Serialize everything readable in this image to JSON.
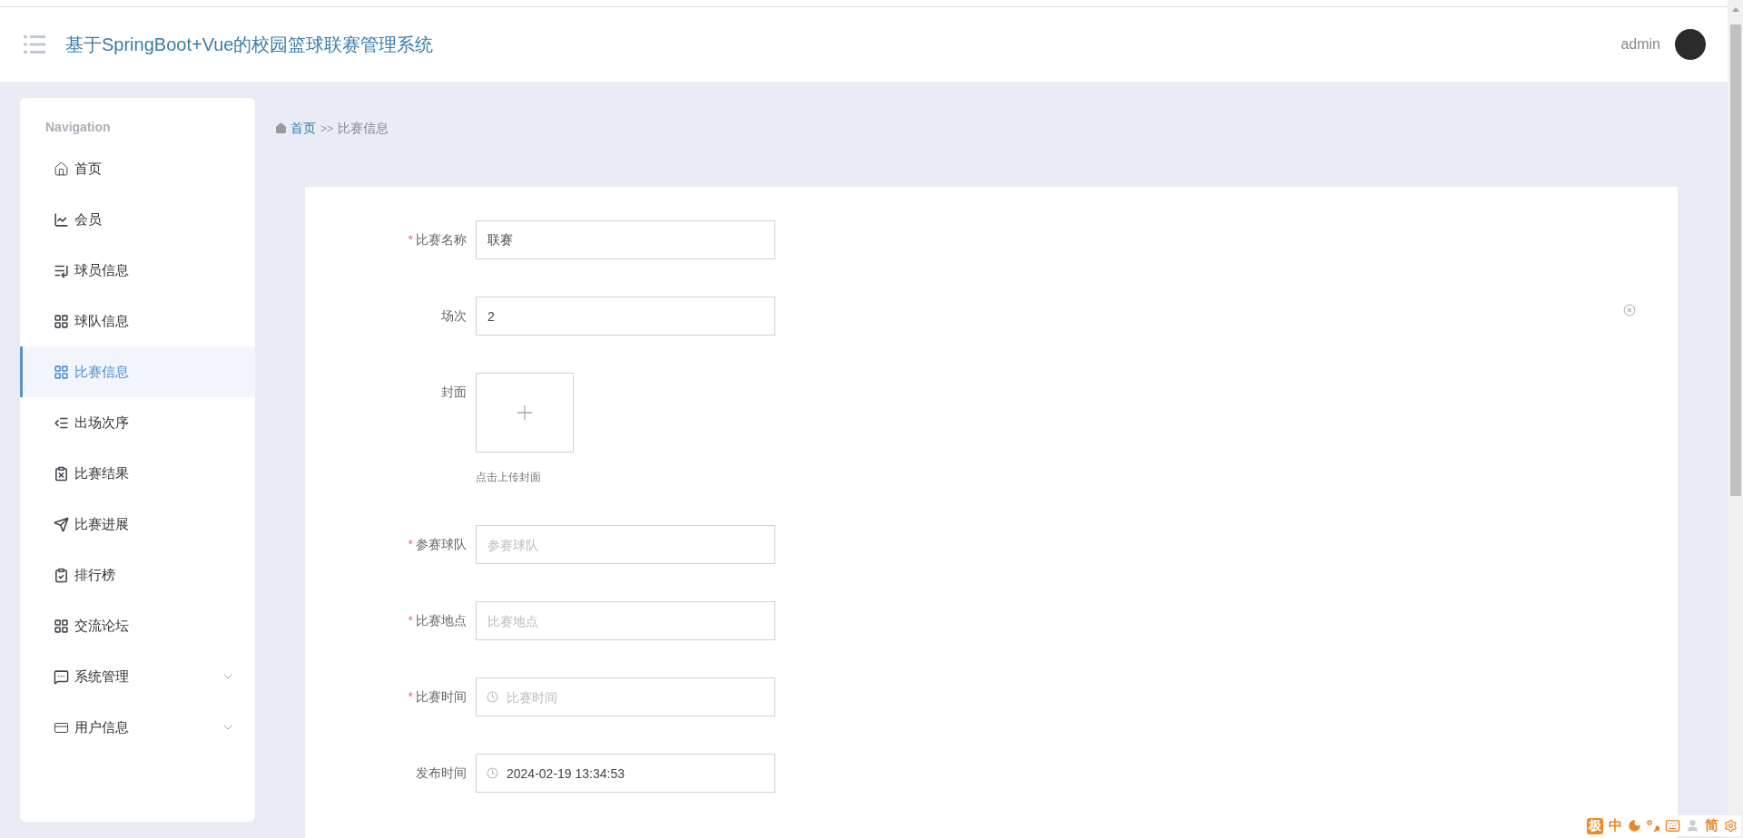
{
  "header": {
    "title": "基于SpringBoot+Vue的校园篮球联赛管理系统",
    "user": "admin"
  },
  "sidebar": {
    "heading": "Navigation",
    "items": [
      {
        "label": "首页",
        "kind": "link",
        "selected": false
      },
      {
        "label": "会员",
        "kind": "link",
        "selected": false
      },
      {
        "label": "球员信息",
        "kind": "link",
        "selected": false
      },
      {
        "label": "球队信息",
        "kind": "link",
        "selected": false
      },
      {
        "label": "比赛信息",
        "kind": "link",
        "selected": true
      },
      {
        "label": "出场次序",
        "kind": "link",
        "selected": false
      },
      {
        "label": "比赛结果",
        "kind": "link",
        "selected": false
      },
      {
        "label": "比赛进展",
        "kind": "link",
        "selected": false
      },
      {
        "label": "排行榜",
        "kind": "link",
        "selected": false
      },
      {
        "label": "交流论坛",
        "kind": "link",
        "selected": false
      },
      {
        "label": "系统管理",
        "kind": "submenu",
        "selected": false
      },
      {
        "label": "用户信息",
        "kind": "submenu",
        "selected": false
      }
    ]
  },
  "breadcrumb": {
    "home": "首页",
    "separator": ">>",
    "current": "比赛信息"
  },
  "form": {
    "fields": [
      {
        "label": "比赛名称",
        "kind": "text",
        "required_mark": "*",
        "value": "联赛"
      },
      {
        "label": "场次",
        "kind": "text",
        "value": "2",
        "clearable": true
      },
      {
        "label": "封面",
        "kind": "upload",
        "hint": "点击上传封面"
      },
      {
        "label": "参赛球队",
        "kind": "text",
        "required_mark": "*",
        "placeholder": "参赛球队"
      },
      {
        "label": "比赛地点",
        "kind": "text",
        "required_mark": "*",
        "placeholder": "比赛地点"
      },
      {
        "label": "比赛时间",
        "kind": "datetime",
        "required_mark": "*",
        "placeholder": "比赛时间"
      },
      {
        "label": "发布时间",
        "kind": "datetime",
        "value": "2024-02-19 13:34:53"
      }
    ]
  },
  "ime_toolbar": {
    "items": [
      {
        "kind": "badge",
        "text": "极"
      },
      {
        "kind": "text",
        "text": "中"
      },
      {
        "kind": "moon"
      },
      {
        "kind": "punctuation"
      },
      {
        "kind": "keyboard"
      },
      {
        "kind": "user"
      },
      {
        "kind": "text",
        "text": "简"
      },
      {
        "kind": "gear"
      }
    ]
  }
}
